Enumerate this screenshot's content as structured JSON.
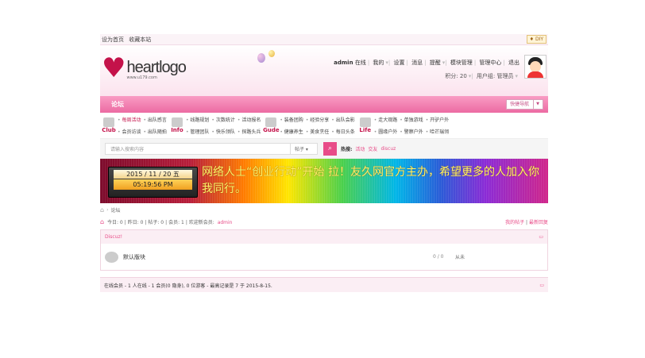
{
  "topbar": {
    "set_home": "设为首页",
    "bookmark": "收藏本站",
    "diy": "DIY"
  },
  "logo": {
    "name": "heartlogo",
    "url": "www.u179.com"
  },
  "user": {
    "name": "admin",
    "status": "在线",
    "links": [
      "我的",
      "设置",
      "消息",
      "提醒",
      "模块管理",
      "管理中心",
      "退出"
    ],
    "points_label": "积分: 20",
    "group_label": "用户组: 管理员"
  },
  "nav": {
    "forum": "论坛",
    "quick_nav": "快捷导航"
  },
  "categories": [
    {
      "label": "Club",
      "links": [
        "每周活动",
        "出队感言",
        "会员访谈",
        "出队随拍"
      ],
      "hot_index": 0
    },
    {
      "label": "Info",
      "links": [
        "线路规划",
        "次数统计",
        "管理团队",
        "快乐领队",
        "活动报名",
        "探路头兵"
      ],
      "hot_index": -1
    },
    {
      "label": "Gude",
      "links": [
        "装备团购",
        "经验分享",
        "健康养生",
        "美食烹任",
        "出队会影",
        "每日头条"
      ],
      "hot_index": -1
    },
    {
      "label": "Life",
      "links": [
        "走大观路",
        "单独游戏",
        "圆缘户外",
        "警察户外",
        "开驴户外",
        "哈芒瑞翎"
      ],
      "hot_index": -1
    }
  ],
  "search": {
    "placeholder": "请输入搜索内容",
    "select": "帖子",
    "hot_label": "热搜:",
    "hot_items": [
      "活动",
      "交友",
      "discuz"
    ]
  },
  "banner": {
    "date": "2015 / 11 / 20  五",
    "time": "05:19:56 PM",
    "text": "网络人士“创业行动”开始 拉！友久网官方主办，希望更多的人加入你我同行。"
  },
  "breadcrumb": {
    "current": "论坛"
  },
  "stats": {
    "today": "今日: 0",
    "yesterday": "昨日: 0",
    "posts": "帖子: 0",
    "members": "会员: 1",
    "welcome": "欢迎新会员: ",
    "new_member": "admin",
    "my_posts": "我的帖子",
    "latest_reply": "最新回复"
  },
  "forum_box": {
    "title": "Discuz!",
    "board": "默认版块",
    "counts": "0 / 0",
    "last": "从未"
  },
  "online": {
    "text": "在线会员 - 1 人在线 - 1 会员(0 隐身), 0 位游客 - 最高记录是 7 于 2015-8-15."
  }
}
